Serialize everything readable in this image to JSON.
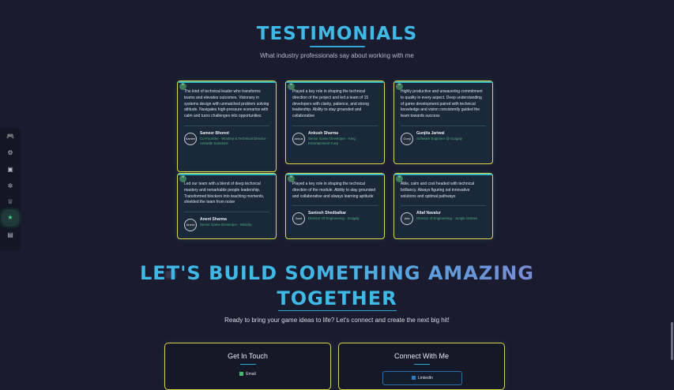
{
  "testimonials": {
    "title": "TESTIMONIALS",
    "subtitle": "What industry professionals say about working with me",
    "cards": [
      {
        "quote": "The kind of technical leader who transforms teams and elevates outcomes. Visionary in systems design with unmatched problem solving attitude. Navigates high-pressure scenarios with calm and turns challenges into opportunities",
        "name": "Sameer Bhonot",
        "role": "Co-Founder - Wootiny & Technical Director - Antrattle Solutions",
        "avatar": "Samee"
      },
      {
        "quote": "Played a key role in shaping the technical direction of the project and led a team of 15 developers with clarity, patience, and strong leadership. Ability to stay grounded and collaborative",
        "name": "Ankush Sharma",
        "role": "Senior Game Developer - King Entertainment Corp",
        "avatar": "Ankus"
      },
      {
        "quote": "Highly productive and unwavering commitment to quality in every aspect. Deep understanding of game development paired with technical knowledge and vision consistently guided the team towards success",
        "name": "Gunjita Jariwal",
        "role": "Software Engineer @ Guigaly",
        "avatar": "Gunji"
      },
      {
        "quote": "Led our team with a blend of deep technical mastery and remarkable people leadership. Transformed blockers into teaching moments, shielded the team from noise",
        "name": "Anent Sharma",
        "role": "Senior Game Developer - Miniclip",
        "avatar": "Anent"
      },
      {
        "quote": "Played a key role in shaping the technical direction of the module. Ability to stay grounded and collaborative and always learning aptitude",
        "name": "Santosh Shedbalkar",
        "role": "Director Of Engineering - Guigaly",
        "avatar": "Sant Tosh"
      },
      {
        "quote": "Able, calm and cool headed with technical brilliancy. Always figuring out innovative solutions and optimal pathways",
        "name": "Altaf Navalur",
        "role": "Director of Engineering - Jungle Games",
        "avatar": "Alta Naval"
      }
    ]
  },
  "dock": {
    "items": [
      {
        "icon": "gamepad-icon",
        "glyph": "🎮"
      },
      {
        "icon": "user-gear-icon",
        "glyph": "⚙"
      },
      {
        "icon": "briefcase-icon",
        "glyph": "▣"
      },
      {
        "icon": "settings-icon",
        "glyph": "✲"
      },
      {
        "icon": "trophy-icon",
        "glyph": "♕"
      },
      {
        "icon": "star-icon",
        "glyph": "★"
      },
      {
        "icon": "chat-icon",
        "glyph": "▤"
      }
    ],
    "active_index": 5
  },
  "cta": {
    "line1": "LET'S BUILD SOMETHING AMAZING",
    "line2": "TOGETHER",
    "subtitle": "Ready to bring your game ideas to life? Let's connect and create the next big hit!"
  },
  "contact": {
    "get_in_touch_title": "Get In Touch",
    "email_label": "Email",
    "connect_title": "Connect With Me",
    "linkedin_label": "LinkedIn"
  },
  "colors": {
    "background": "#1a1b2e",
    "accent_cyan": "#3fb8e6",
    "accent_purple": "#9a70c9",
    "card_border": "#e4d54a",
    "active_green": "#47d38a"
  }
}
